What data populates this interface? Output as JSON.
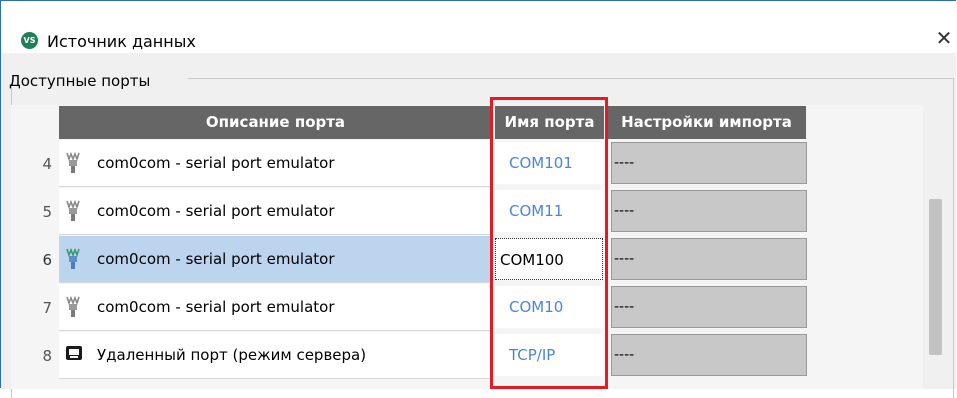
{
  "window": {
    "title": "Источник данных",
    "app_icon_label": "VS",
    "close_glyph": "✕"
  },
  "group": {
    "label": "Доступные порты"
  },
  "table": {
    "columns": [
      "Описание порта",
      "Имя порта",
      "Настройки импорта"
    ],
    "rows": [
      {
        "num": "4",
        "description": "com0com - serial port emulator",
        "port": "COM101",
        "import": "----",
        "icon": "serial-port-icon",
        "selected": false
      },
      {
        "num": "5",
        "description": "com0com - serial port emulator",
        "port": "COM11",
        "import": "----",
        "icon": "serial-port-icon",
        "selected": false
      },
      {
        "num": "6",
        "description": "com0com - serial port emulator",
        "port": "COM100",
        "import": "----",
        "icon": "serial-port-icon",
        "selected": true
      },
      {
        "num": "7",
        "description": "com0com - serial port emulator",
        "port": "COM10",
        "import": "----",
        "icon": "serial-port-icon",
        "selected": false
      },
      {
        "num": "8",
        "description": "Удаленный порт (режим сервера)",
        "port": "TCP/IP",
        "import": "----",
        "icon": "remote-port-icon",
        "selected": false
      }
    ]
  },
  "colors": {
    "header_bg": "#666666",
    "selected_row": "#bcd4ee",
    "port_link": "#4a86d8",
    "highlight_border": "#e41b23"
  }
}
